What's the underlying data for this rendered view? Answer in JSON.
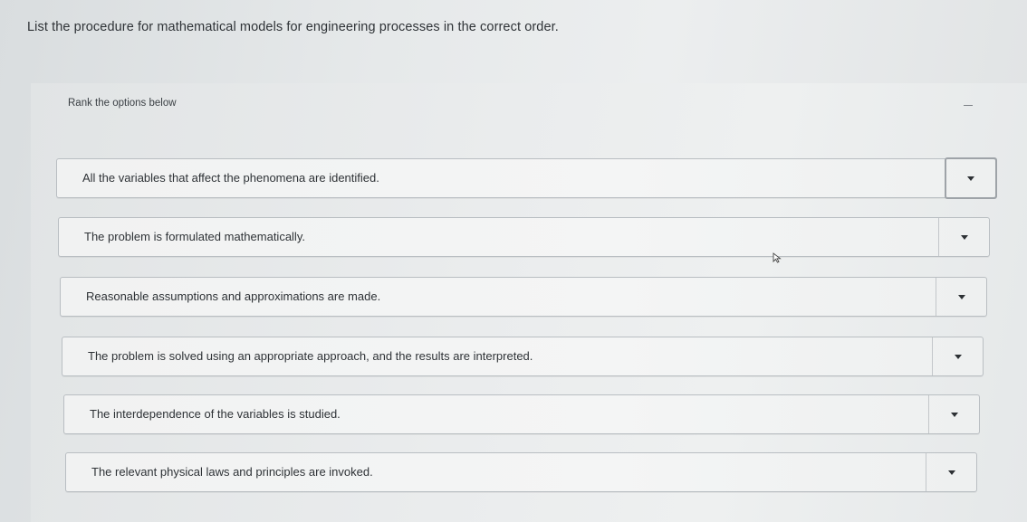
{
  "question": {
    "text": "List the procedure for mathematical models for engineering processes in the correct order."
  },
  "panel": {
    "instruction": "Rank the options below",
    "collapse_icon": "minus-icon"
  },
  "rank_items": [
    {
      "label": "All the variables that affect the phenomena are identified.",
      "dropdown_icon": "caret-down-icon"
    },
    {
      "label": "The problem is formulated mathematically.",
      "dropdown_icon": "caret-down-icon"
    },
    {
      "label": "Reasonable assumptions and approximations are made.",
      "dropdown_icon": "caret-down-icon"
    },
    {
      "label": "The problem is solved using an appropriate approach, and the results are interpreted.",
      "dropdown_icon": "caret-down-icon"
    },
    {
      "label": "The interdependence of the variables is studied.",
      "dropdown_icon": "caret-down-icon"
    },
    {
      "label": "The relevant physical laws and principles are invoked.",
      "dropdown_icon": "caret-down-icon"
    }
  ],
  "cursor_icon": "mouse-pointer-icon"
}
